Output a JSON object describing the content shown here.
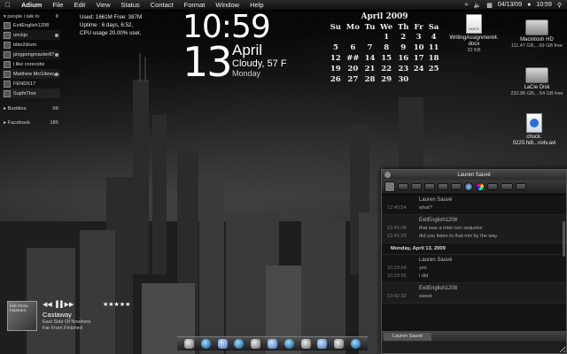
{
  "menubar": {
    "apple": "",
    "items": [
      "Adium",
      "File",
      "Edit",
      "View",
      "Status",
      "Contact",
      "Format",
      "Window",
      "Help"
    ],
    "date": "04/13/09",
    "time": "10:59"
  },
  "buddy_list": {
    "group_label": "people i talk to",
    "group_count": "8",
    "buddies": [
      "ExitEnglish1208",
      "unckjo",
      "bike2drum",
      "pingpongmaster87",
      "i like corecobs",
      "Matthew McGibney",
      "FENDX17",
      "SupfsThor"
    ],
    "groups": [
      {
        "label": "Buddies",
        "count": "66"
      },
      {
        "label": "Facebook",
        "count": "185"
      }
    ]
  },
  "stats": {
    "line1": "Used: 1661M Free: 387M",
    "line2": "Uptime : 6 days, 6:52,",
    "line3": "CPU usage  20.00% user,"
  },
  "clock": {
    "time": "10:59",
    "day": "13",
    "month": "April",
    "weather": "Cloudy, 57 F",
    "weekday": "Monday"
  },
  "calendar": {
    "title": "April 2009",
    "headers": [
      "Su",
      "Mo",
      "Tu",
      "We",
      "Th",
      "Fr",
      "Sa"
    ],
    "weeks": [
      [
        "",
        "",
        "",
        "1",
        "2",
        "3",
        "4"
      ],
      [
        "5",
        "6",
        "7",
        "8",
        "9",
        "10",
        "11"
      ],
      [
        "12",
        "##",
        "14",
        "15",
        "16",
        "17",
        "18"
      ],
      [
        "19",
        "20",
        "21",
        "22",
        "23",
        "24",
        "25"
      ],
      [
        "26",
        "27",
        "28",
        "29",
        "30",
        "",
        ""
      ]
    ]
  },
  "desktop_icons": {
    "doc": {
      "name1": "WritingAssignment4.",
      "name2": "docx",
      "size": "22 KB"
    },
    "hd": {
      "name": "Macintosh HD",
      "info": "111.47 GB,...69 GB free"
    },
    "lacie": {
      "name": "LaCie Disk",
      "info": "232.86 GB,...54 GB free"
    },
    "avi": {
      "name1": "chuck.",
      "name2": "0220.hdt...notv.avi"
    }
  },
  "music": {
    "art_text": "FAR FROM FINISHED",
    "controls": "◀◀ ▐▐ ▶▶",
    "stars": "★★★★★",
    "title": "Castaway",
    "artist": "East Side Of Nowhere",
    "album": "Far From Finished"
  },
  "chat": {
    "window_title": "Lauren Sauvé",
    "tab_label": "Lauren Sauvé",
    "blocks": [
      {
        "sender": "Lauren Sauvé",
        "lines": [
          {
            "ts": "12:40:54",
            "text": "what?"
          }
        ]
      },
      {
        "sender": "ExitEnglish1208",
        "lines": [
          {
            "ts": "12:41:06",
            "text": "that was a total non sequetor"
          },
          {
            "ts": "12:41:29",
            "text": "did you listen to that mix by the way"
          }
        ]
      }
    ],
    "day_divider": "Monday, April 13, 2009",
    "blocks2": [
      {
        "sender": "Lauren Sauvé",
        "lines": [
          {
            "ts": "10:23:54",
            "text": "yes"
          },
          {
            "ts": "10:23:56",
            "text": "i did"
          }
        ]
      },
      {
        "sender": "ExitEnglish1208",
        "lines": [
          {
            "ts": "10:42:32",
            "text": "sweet"
          }
        ]
      }
    ]
  }
}
